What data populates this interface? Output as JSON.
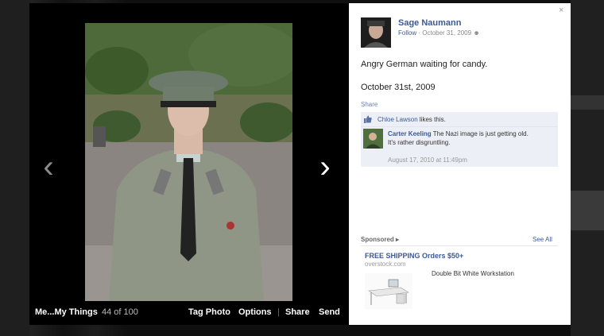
{
  "viewer": {
    "album_title": "Me...My Things",
    "photo_count": "44 of 100",
    "actions": {
      "tag_photo": "Tag Photo",
      "options": "Options",
      "separator": "|",
      "share": "Share",
      "send": "Send"
    },
    "prev_arrow": "‹",
    "next_arrow": "›"
  },
  "panel": {
    "close": "×",
    "author": "Sage Naumann",
    "follow": "Follow",
    "meta_date": "· October 31, 2009",
    "caption": "Angry German waiting for candy.",
    "caption_date": "October 31st, 2009",
    "share_label": "Share",
    "likes": {
      "name": "Chloe Lawson",
      "suffix": " likes this."
    },
    "comment": {
      "author": "Carter Keeling",
      "text": " The Nazi image is just getting old.",
      "text2": "It's rather disgruntling.",
      "date": "August 17, 2010 at 11:49pm"
    },
    "sponsored": {
      "label": "Sponsored",
      "see_all": "See All",
      "ad_title": "FREE SHIPPING Orders $50+",
      "ad_domain": "overstock.com",
      "ad_desc": "Double Bit White Workstation"
    }
  },
  "colors": {
    "link": "#3b5998",
    "panel_bg": "#ffffff",
    "stage_bg": "#000000",
    "comment_bg": "#eceff5"
  }
}
